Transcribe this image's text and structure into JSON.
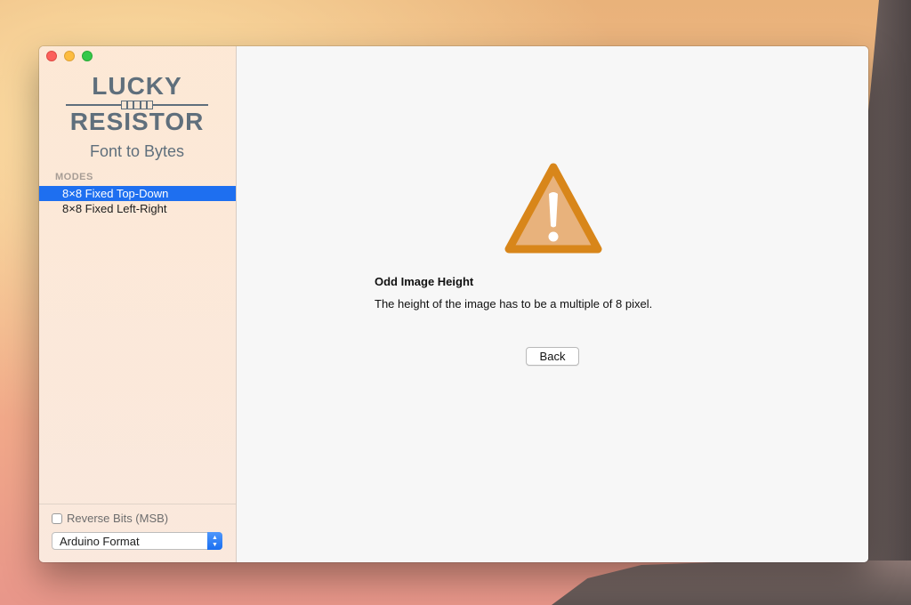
{
  "window": {
    "controls": [
      "close",
      "minimize",
      "zoom"
    ]
  },
  "logo": {
    "line1": "LUCKY",
    "line2": "RESISTOR",
    "subtitle": "Font to Bytes"
  },
  "sidebar": {
    "section_header": "MODES",
    "modes": [
      {
        "label": "8×8 Fixed Top-Down",
        "selected": true
      },
      {
        "label": "8×8 Fixed Left-Right",
        "selected": false
      }
    ],
    "reverse_bits_label": "Reverse Bits (MSB)",
    "reverse_bits_checked": false,
    "format_select": {
      "value": "Arduino Format"
    }
  },
  "main": {
    "icon": "warning-triangle-icon",
    "error_title": "Odd Image Height",
    "error_message": "The height of the image has to be a multiple of 8 pixel.",
    "back_label": "Back"
  },
  "colors": {
    "selection": "#1e6ff0",
    "warning_fill": "#e8b27c",
    "warning_stroke": "#d8861a",
    "logo": "#5f6f7c"
  }
}
